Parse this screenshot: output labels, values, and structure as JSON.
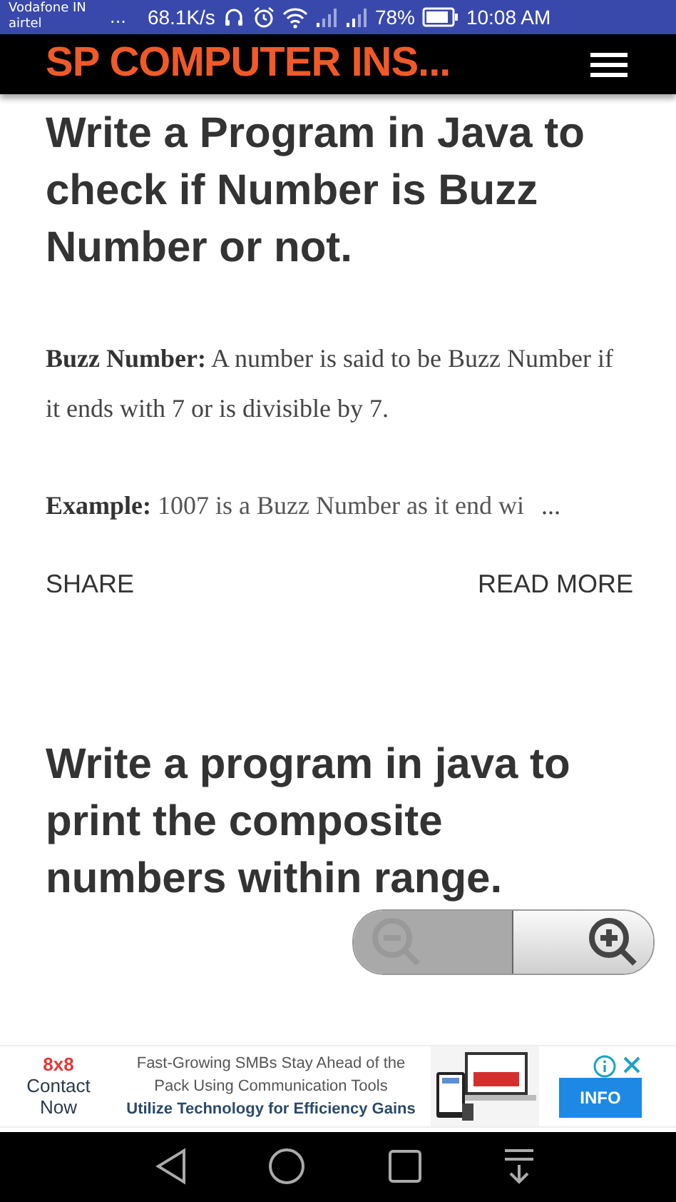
{
  "status_bar": {
    "carrier_1": "Vodafone IN",
    "carrier_2": "airtel",
    "more": "...",
    "speed": "68.1K/s",
    "battery": "78%",
    "time": "10:08 AM"
  },
  "header": {
    "title": "SP COMPUTER INS..."
  },
  "posts": [
    {
      "title": "Write a Program in Java to check if Number is Buzz Number or not.",
      "paragraphs": [
        "**Buzz Number:** A number is said to be Buzz Number if it ends with 7 or is divisible by 7.",
        "**Example:** 1007 is a Buzz Number as it end wi"
      ],
      "ellipsis": "...",
      "share": "SHARE",
      "read_more": "READ MORE"
    },
    {
      "title": "Write a program in java to print the composite numbers within range."
    }
  ],
  "ad": {
    "brand": "8x8",
    "cta_1": "Contact",
    "cta_2": "Now",
    "line_1": "Fast-Growing SMBs Stay Ahead of the",
    "line_2": "Pack Using Communication Tools",
    "line_3": "Utilize Technology for Efficiency Gains",
    "button": "INFO"
  }
}
